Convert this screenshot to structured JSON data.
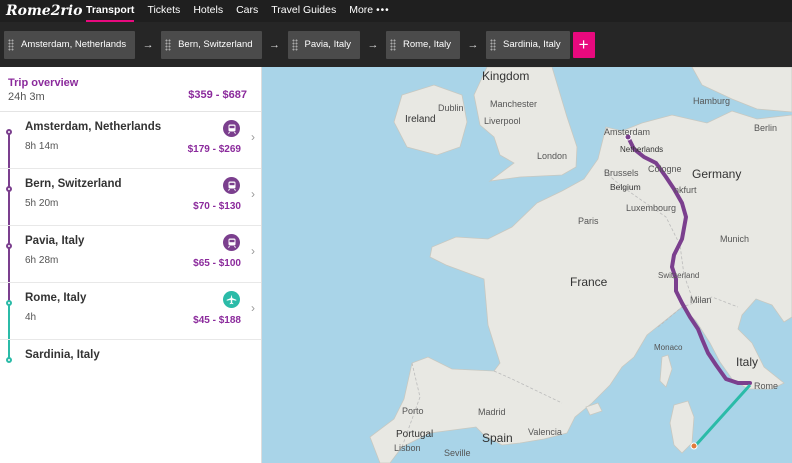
{
  "header": {
    "logo": "Rome2rio",
    "nav": [
      {
        "label": "Transport",
        "active": true
      },
      {
        "label": "Tickets"
      },
      {
        "label": "Hotels"
      },
      {
        "label": "Cars"
      },
      {
        "label": "Travel Guides"
      },
      {
        "label": "More"
      }
    ],
    "more_dots": "•••"
  },
  "route": {
    "stops": [
      "Amsterdam, Netherlands",
      "Bern, Switzerland",
      "Pavia, Italy",
      "Rome, Italy",
      "Sardinia, Italy"
    ],
    "arrow": "→",
    "add_label": "+"
  },
  "trip": {
    "title": "Trip overview",
    "duration": "24h 3m",
    "price": "$359 - $687",
    "segments": [
      {
        "city": "Amsterdam, Netherlands",
        "duration": "8h 14m",
        "price": "$179 - $269",
        "mode": "train"
      },
      {
        "city": "Bern, Switzerland",
        "duration": "5h 20m",
        "price": "$70 - $130",
        "mode": "train"
      },
      {
        "city": "Pavia, Italy",
        "duration": "6h 28m",
        "price": "$65 - $100",
        "mode": "train"
      },
      {
        "city": "Rome, Italy",
        "duration": "4h",
        "price": "$45 - $188",
        "mode": "plane"
      },
      {
        "city": "Sardinia, Italy"
      }
    ]
  },
  "map": {
    "labels": {
      "kingdom": "Kingdom",
      "ireland": "Ireland",
      "dublin": "Dublin",
      "manchester": "Manchester",
      "liverpool": "Liverpool",
      "london": "London",
      "hamburg": "Hamburg",
      "berlin": "Berlin",
      "amsterdam": "Amsterdam",
      "netherlands": "Netherlands",
      "germany": "Germany",
      "brussels": "Brussels",
      "belgium": "Belgium",
      "cologne": "Cologne",
      "frankfurt": "nkfurt",
      "luxembourg": "Luxembourg",
      "paris": "Paris",
      "munich": "Munich",
      "france": "France",
      "switzerland": "Switzerland",
      "milan": "Milan",
      "monaco": "Monaco",
      "italy": "Italy",
      "rome": "Rome",
      "porto": "Porto",
      "madrid": "Madrid",
      "portugal": "Portugal",
      "spain": "Spain",
      "lisbon": "Lisbon",
      "valencia": "Valencia",
      "seville": "Seville"
    }
  },
  "colors": {
    "accent": "#e8097e",
    "route_train": "#7b3f8e",
    "route_flight": "#2bbba8"
  }
}
